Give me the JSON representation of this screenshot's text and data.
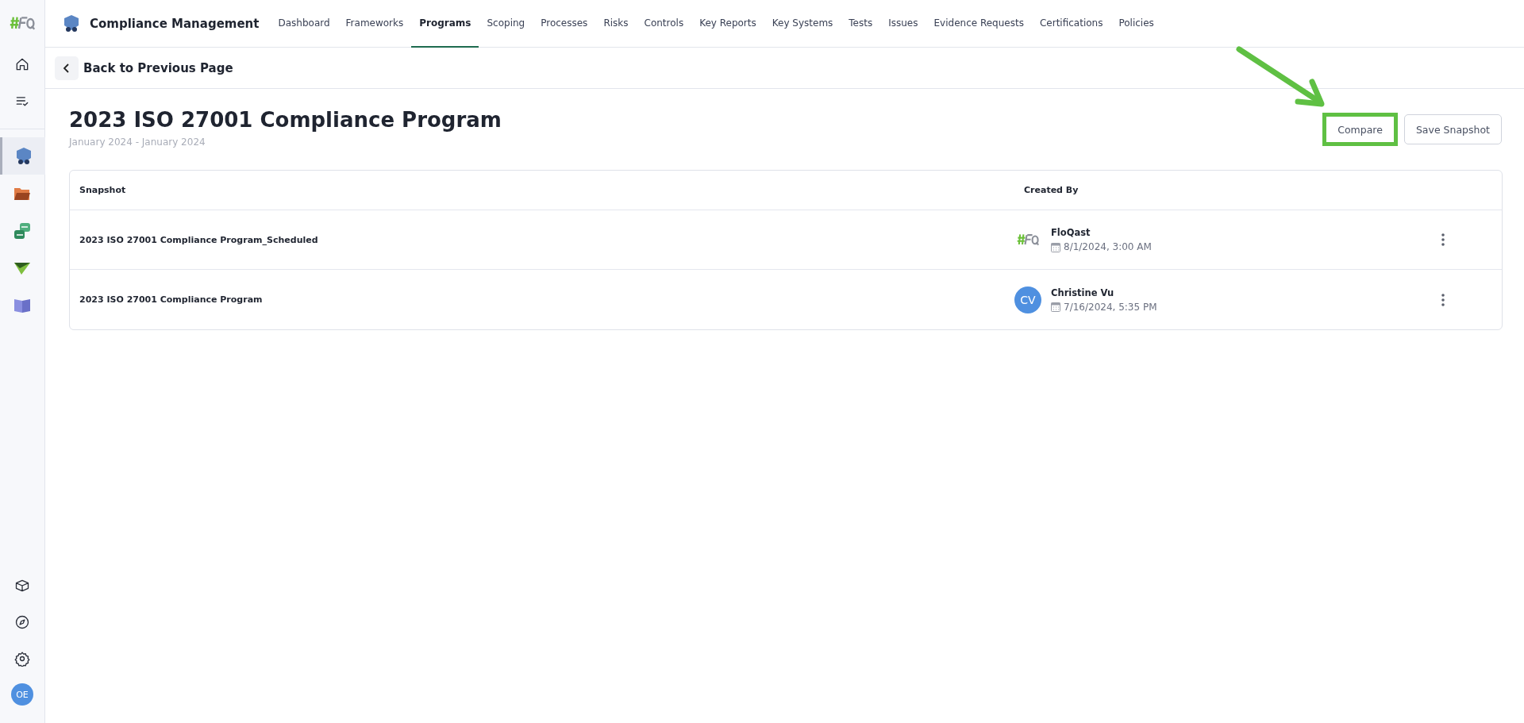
{
  "sidebar": {
    "top_items": [
      {
        "kind": "home",
        "selected": false
      },
      {
        "kind": "tasks",
        "selected": false
      }
    ],
    "apps": [
      {
        "kind": "shield",
        "selected": true
      },
      {
        "kind": "folder",
        "selected": false
      },
      {
        "kind": "sync",
        "selected": false
      },
      {
        "kind": "plane",
        "selected": false
      },
      {
        "kind": "book",
        "selected": false
      }
    ],
    "bottom_items": [
      {
        "kind": "cube"
      },
      {
        "kind": "compass"
      },
      {
        "kind": "gear"
      }
    ],
    "user_avatar": "OE"
  },
  "header": {
    "app_title": "Compliance Management",
    "tabs": [
      {
        "label": "Dashboard",
        "selected": false
      },
      {
        "label": "Frameworks",
        "selected": false
      },
      {
        "label": "Programs",
        "selected": true
      },
      {
        "label": "Scoping",
        "selected": false
      },
      {
        "label": "Processes",
        "selected": false
      },
      {
        "label": "Risks",
        "selected": false
      },
      {
        "label": "Controls",
        "selected": false
      },
      {
        "label": "Key Reports",
        "selected": false
      },
      {
        "label": "Key Systems",
        "selected": false
      },
      {
        "label": "Tests",
        "selected": false
      },
      {
        "label": "Issues",
        "selected": false
      },
      {
        "label": "Evidence Requests",
        "selected": false
      },
      {
        "label": "Certifications",
        "selected": false
      },
      {
        "label": "Policies",
        "selected": false
      }
    ]
  },
  "back_link": "Back to Previous Page",
  "page": {
    "title": "2023 ISO 27001 Compliance Program",
    "date_range": "January 2024 - January 2024",
    "buttons": [
      {
        "label": "Compare",
        "highlighted": true
      },
      {
        "label": "Save Snapshot",
        "highlighted": false
      }
    ]
  },
  "table": {
    "columns": [
      "Snapshot",
      "Created By"
    ],
    "rows": [
      {
        "snapshot": "2023 ISO 27001 Compliance Program_Scheduled",
        "creator": "FloQast",
        "kind": "logo",
        "created": "8/1/2024, 3:00 AM"
      },
      {
        "snapshot": "2023 ISO 27001 Compliance Program",
        "creator": "Christine Vu",
        "kind": "initials",
        "avatar": "CV",
        "created": "7/16/2024, 5:35 PM"
      }
    ]
  }
}
